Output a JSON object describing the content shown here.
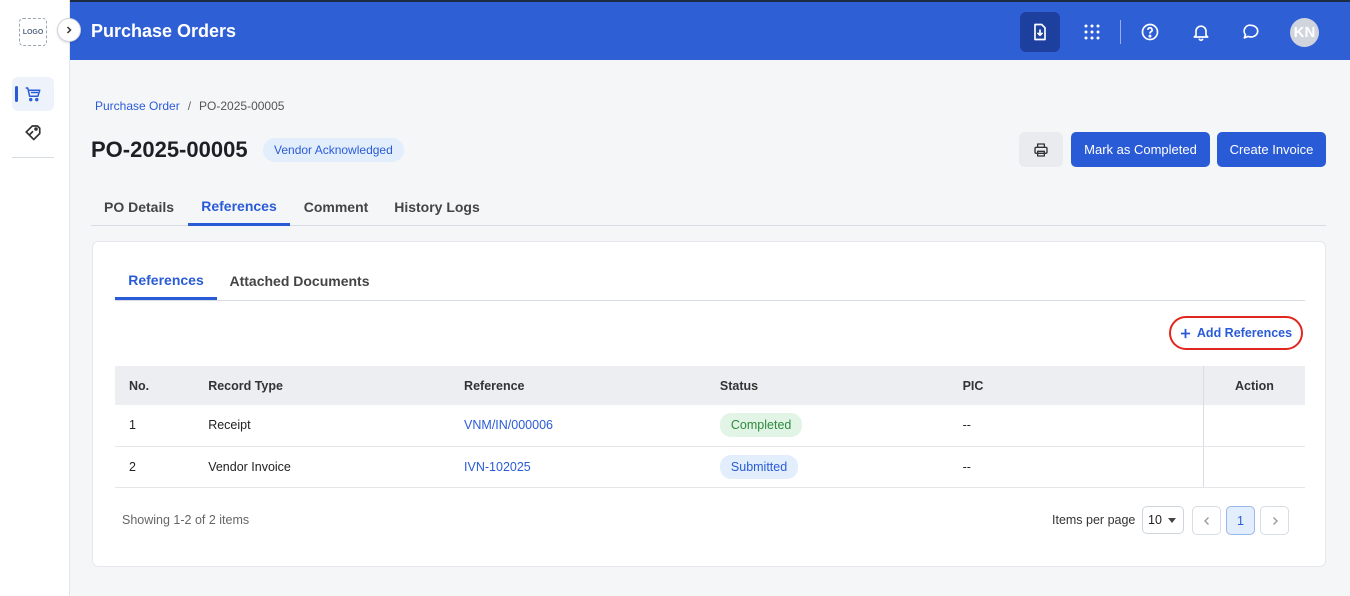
{
  "app": {
    "title": "Purchase Orders",
    "logo_text": "LOGO",
    "user_initials": "KN"
  },
  "icons": {
    "collapse": "chevron-right-icon",
    "cart": "cart-icon",
    "tag": "tag-icon",
    "download": "download-doc-icon",
    "grid": "apps-grid-icon",
    "help": "help-icon",
    "bell": "bell-icon",
    "chat": "chat-icon",
    "print": "printer-icon",
    "plus": "plus-icon"
  },
  "breadcrumb": {
    "parent": "Purchase Order",
    "separator": "/",
    "current": "PO-2025-00005"
  },
  "page": {
    "title": "PO-2025-00005",
    "status": "Vendor Acknowledged"
  },
  "actions": {
    "mark_completed": "Mark as Completed",
    "create_invoice": "Create Invoice"
  },
  "tabs": [
    {
      "label": "PO Details"
    },
    {
      "label": "References",
      "active": true
    },
    {
      "label": "Comment"
    },
    {
      "label": "History Logs"
    }
  ],
  "subtabs": [
    {
      "label": "References",
      "active": true
    },
    {
      "label": "Attached Documents"
    }
  ],
  "add_references": "Add References",
  "table": {
    "headers": [
      "No.",
      "Record Type",
      "Reference",
      "Status",
      "PIC",
      "Action"
    ],
    "rows": [
      {
        "no": "1",
        "record_type": "Receipt",
        "reference": "VNM/IN/000006",
        "status": "Completed",
        "pic": "--"
      },
      {
        "no": "2",
        "record_type": "Vendor Invoice",
        "reference": "IVN-102025",
        "status": "Submitted",
        "pic": "--"
      }
    ]
  },
  "pagination": {
    "showing": "Showing 1-2 of 2 items",
    "items_per_page_label": "Items per page",
    "items_per_page": "10",
    "current_page": "1"
  },
  "colors": {
    "header": "#2f5fd5",
    "accent": "#2a5bd7",
    "highlight_ring": "#e0271f",
    "completed": "#2e8a3e"
  }
}
